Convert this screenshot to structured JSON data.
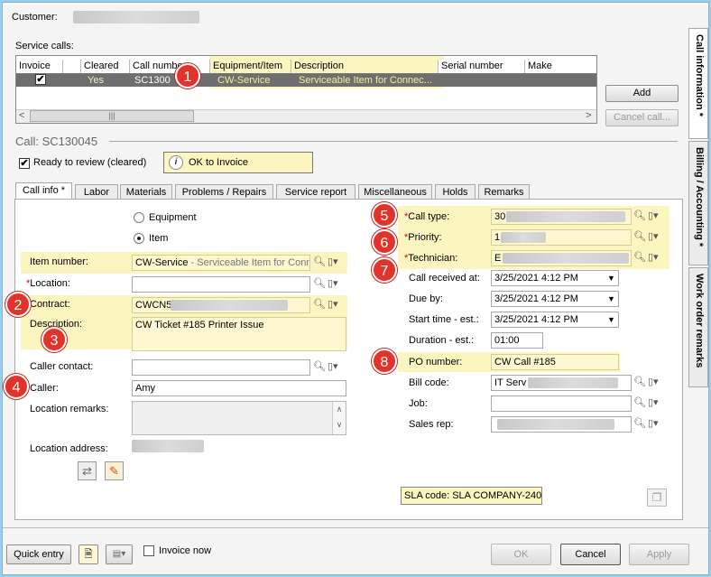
{
  "header": {
    "customer_label": "Customer:"
  },
  "service_calls": {
    "label": "Service calls:",
    "columns": [
      "Invoice",
      "",
      "Cleared",
      "Call number",
      "Equipment/Item",
      "Description",
      "Serial number",
      "Make"
    ],
    "row": {
      "invoice_checked": true,
      "cleared": "Yes",
      "call_number": "SC1300",
      "equipment": "CW-Service",
      "description": "Serviceable Item for Connec..."
    },
    "add_button": "Add",
    "cancel_call_button": "Cancel call..."
  },
  "call": {
    "title": "Call: SC130045",
    "ready_to_review": "Ready to review (cleared)",
    "ok_to_invoice": "OK to Invoice"
  },
  "tabs": [
    "Call info *",
    "Labor",
    "Materials",
    "Problems / Repairs",
    "Service report",
    "Miscellaneous",
    "Holds",
    "Remarks"
  ],
  "side_tabs": [
    "Call information *",
    "Billing / Accounting *",
    "Work order remarks"
  ],
  "left": {
    "radio_equipment": "Equipment",
    "radio_item": "Item",
    "item_number_label": "Item number:",
    "item_number_value": "CW-Service",
    "item_number_desc": " - Serviceable Item for Conne",
    "location_label": "Location:",
    "contract_label": "Contract:",
    "contract_value": "CWCN5",
    "description_label": "Description:",
    "description_value": "CW Ticket #185 Printer Issue",
    "caller_contact_label": "Caller contact:",
    "caller_label": "Caller:",
    "caller_value": "Amy",
    "location_remarks_label": "Location remarks:",
    "location_address_label": "Location address:"
  },
  "right": {
    "call_type_label": "Call type:",
    "call_type_value": "30",
    "priority_label": "Priority:",
    "priority_value": "1",
    "technician_label": "Technician:",
    "technician_value": "E",
    "call_received_label": "Call received at:",
    "call_received_value": "3/25/2021   4:12 PM",
    "due_by_label": "Due by:",
    "due_by_value": "3/25/2021   4:12 PM",
    "start_time_label": "Start time - est.:",
    "start_time_value": "3/25/2021   4:12 PM",
    "duration_label": "Duration - est.:",
    "duration_value": "01:00",
    "po_number_label": "PO number:",
    "po_number_value": "CW Call #185",
    "bill_code_label": "Bill code:",
    "bill_code_value": "IT Serv",
    "job_label": "Job:",
    "sales_rep_label": "Sales rep:",
    "sla_code": "SLA code: SLA COMPANY-240"
  },
  "badges": [
    "1",
    "2",
    "3",
    "4",
    "5",
    "6",
    "7",
    "8"
  ],
  "footer": {
    "quick_entry": "Quick entry",
    "invoice_now": "Invoice now",
    "ok": "OK",
    "cancel": "Cancel",
    "apply": "Apply"
  },
  "icons": {
    "lookup": "magnifier-icon",
    "menu": "document-dropdown-icon"
  },
  "colors": {
    "highlight": "#fbf5c0",
    "selected_row": "#6e6e6e",
    "badge": "#e2332a",
    "required": "#dd0000"
  }
}
